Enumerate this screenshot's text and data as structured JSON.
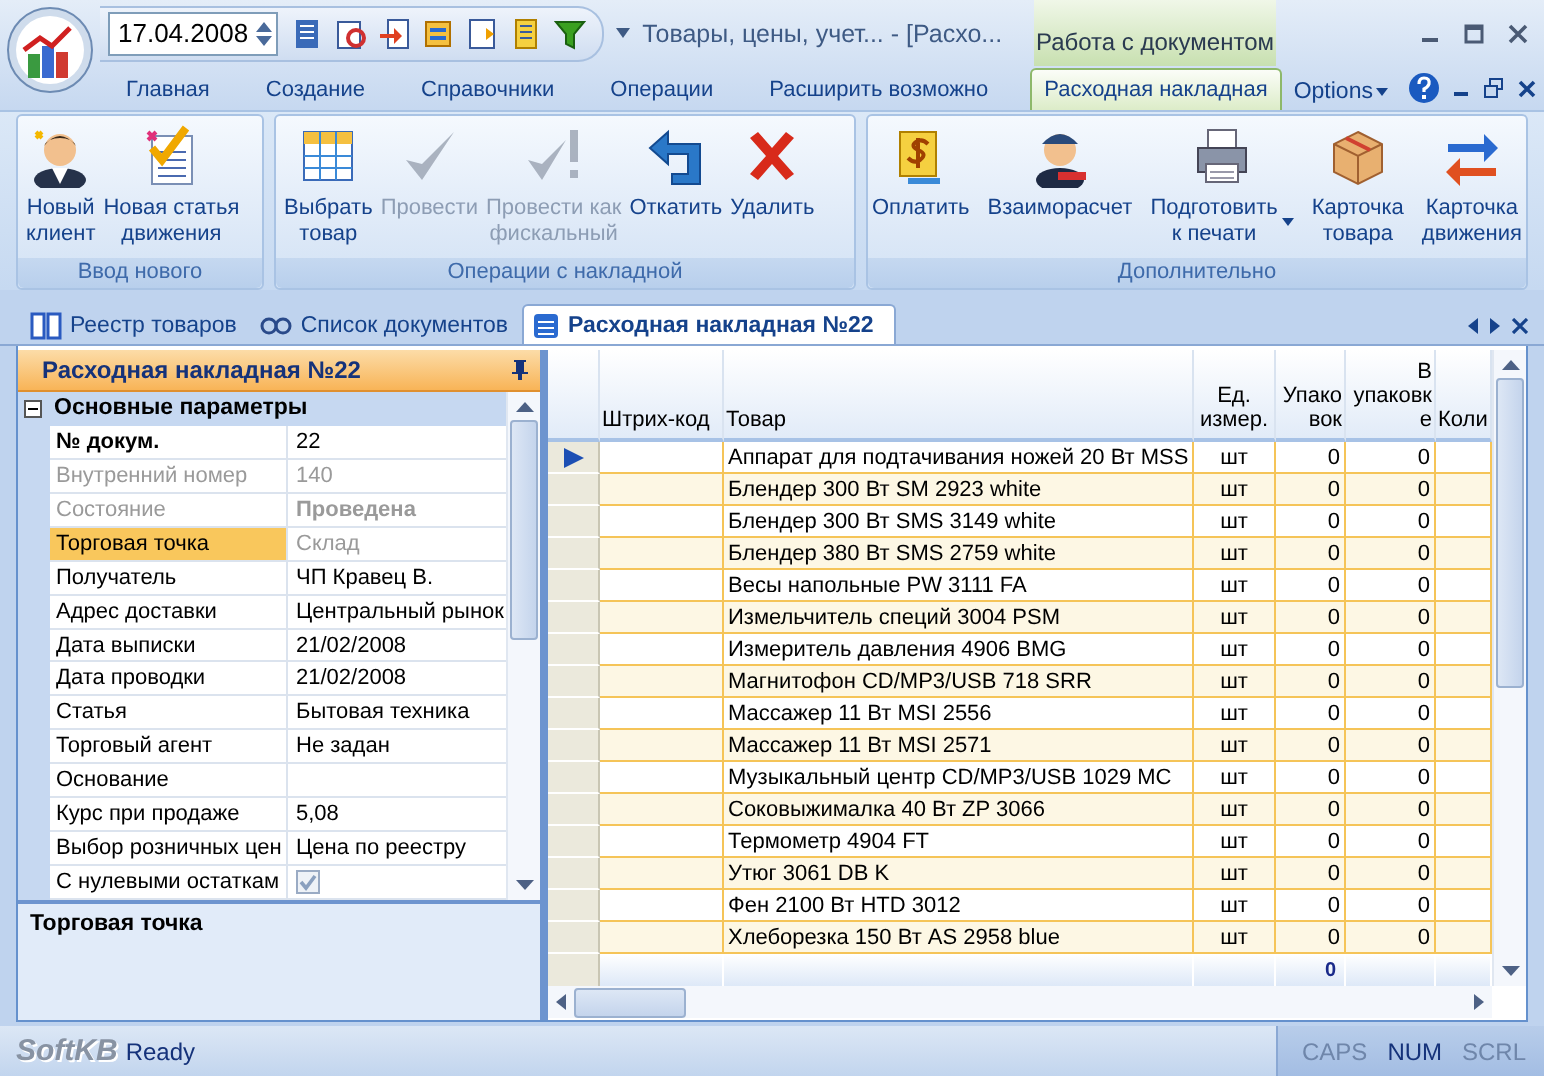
{
  "app": {
    "date": "17.04.2008",
    "title": "Товары, цены, учет... - [Расхо...",
    "contextual_group": "Работа с документом"
  },
  "ribbon_tabs": [
    {
      "label": "Главная",
      "selected": false,
      "contextual": false
    },
    {
      "label": "Создание",
      "selected": false,
      "contextual": false
    },
    {
      "label": "Справочники",
      "selected": false,
      "contextual": false
    },
    {
      "label": "Операции",
      "selected": false,
      "contextual": false
    },
    {
      "label": "Расширить возможно",
      "selected": false,
      "contextual": false
    },
    {
      "label": "Расходная накладная",
      "selected": true,
      "contextual": true
    }
  ],
  "options": "Options",
  "ribbon_groups": [
    {
      "title": "Ввод нового",
      "buttons": [
        {
          "label": "Новый\nклиент",
          "disabled": false
        },
        {
          "label": "Новая статья\nдвижения",
          "disabled": false
        }
      ]
    },
    {
      "title": "Операции с накладной",
      "buttons": [
        {
          "label": "Выбрать\nтовар",
          "disabled": false
        },
        {
          "label": "Провести",
          "disabled": true
        },
        {
          "label": "Провести как\nфискальный",
          "disabled": true
        },
        {
          "label": "Откатить",
          "disabled": false
        },
        {
          "label": "Удалить",
          "disabled": false
        }
      ]
    },
    {
      "title": "Дополнительно",
      "buttons": [
        {
          "label": "Оплатить",
          "disabled": false
        },
        {
          "label": "Взаиморасчет",
          "disabled": false
        },
        {
          "label": "Подготовить\nк печати",
          "disabled": false,
          "dropdown": true
        },
        {
          "label": "Карточка\nтовара",
          "disabled": false
        },
        {
          "label": "Карточка\nдвижения",
          "disabled": false
        }
      ]
    }
  ],
  "doc_tabs": [
    {
      "label": "Реестр товаров",
      "selected": false
    },
    {
      "label": "Список документов",
      "selected": false
    },
    {
      "label": "Расходная накладная №22",
      "selected": true
    }
  ],
  "property_panel": {
    "title": "Расходная накладная №22",
    "category": {
      "label": "Основные параметры",
      "expanded": true
    },
    "properties": [
      {
        "name": "№ докум.",
        "value": "22",
        "kind": "key",
        "disabled": false,
        "selected": false
      },
      {
        "name": "Внутренний номер",
        "value": "140",
        "kind": "text",
        "disabled": true,
        "selected": false
      },
      {
        "name": "Состояние",
        "value": "Проведена",
        "kind": "status",
        "disabled": true,
        "selected": false
      },
      {
        "name": "Торговая точка",
        "value": "Склад",
        "kind": "text",
        "disabled": true,
        "selected": true
      },
      {
        "name": "Получатель",
        "value": "ЧП Кравец В.",
        "kind": "text",
        "disabled": false,
        "selected": false
      },
      {
        "name": "Адрес доставки",
        "value": "Центральный рынок",
        "kind": "text",
        "disabled": false,
        "selected": false
      },
      {
        "name": "Дата выписки",
        "value": "21/02/2008",
        "kind": "text",
        "disabled": false,
        "selected": false
      },
      {
        "name": "Дата проводки",
        "value": "21/02/2008",
        "kind": "text",
        "disabled": false,
        "selected": false
      },
      {
        "name": "Статья",
        "value": "Бытовая техника",
        "kind": "text",
        "disabled": false,
        "selected": false
      },
      {
        "name": "Торговый агент",
        "value": "Не задан",
        "kind": "text",
        "disabled": false,
        "selected": false
      },
      {
        "name": "Основание",
        "kind": "text",
        "disabled": false,
        "selected": false
      },
      {
        "name": "Курс при продаже",
        "value": "5,08",
        "kind": "text",
        "disabled": false,
        "selected": false
      },
      {
        "name": "Выбор розничных цен",
        "value": "Цена по реестру",
        "kind": "text",
        "disabled": false,
        "selected": false
      },
      {
        "name": "С нулевыми остаткам",
        "kind": "checkbox",
        "checked": true,
        "disabled": false,
        "selected": false
      }
    ],
    "description": "Торговая точка"
  },
  "grid": {
    "columns": [
      "Штрих-код",
      "Товар",
      "Ед. измер.",
      "Упаковок",
      "В упаковке",
      "Коли"
    ],
    "rows": [
      {
        "product": "Аппарат для подтачивания ножей 20 Вт MSS",
        "unit": "шт",
        "packs": "0",
        "per_pack": "0",
        "current": true
      },
      {
        "product": "Блендер 300 Вт SM 2923 white",
        "unit": "шт",
        "packs": "0",
        "per_pack": "0",
        "current": false
      },
      {
        "product": "Блендер 300 Вт SMS 3149 white",
        "unit": "шт",
        "packs": "0",
        "per_pack": "0",
        "current": false
      },
      {
        "product": "Блендер 380 Вт SMS 2759 white",
        "unit": "шт",
        "packs": "0",
        "per_pack": "0",
        "current": false
      },
      {
        "product": "Весы напольные PW 3111 FA",
        "unit": "шт",
        "packs": "0",
        "per_pack": "0",
        "current": false
      },
      {
        "product": "Измельчитель специй 3004 PSM",
        "unit": "шт",
        "packs": "0",
        "per_pack": "0",
        "current": false
      },
      {
        "product": "Измеритель давления 4906 BMG",
        "unit": "шт",
        "packs": "0",
        "per_pack": "0",
        "current": false
      },
      {
        "product": "Магнитофон CD/MP3/USB 718 SRR",
        "unit": "шт",
        "packs": "0",
        "per_pack": "0",
        "current": false
      },
      {
        "product": "Массажер 11 Вт MSI 2556",
        "unit": "шт",
        "packs": "0",
        "per_pack": "0",
        "current": false
      },
      {
        "product": "Массажер 11 Вт MSI 2571",
        "unit": "шт",
        "packs": "0",
        "per_pack": "0",
        "current": false
      },
      {
        "product": "Музыкальный центр CD/MP3/USB 1029 MC",
        "unit": "шт",
        "packs": "0",
        "per_pack": "0",
        "current": false
      },
      {
        "product": "Соковыжималка 40 Вт ZP 3066",
        "unit": "шт",
        "packs": "0",
        "per_pack": "0",
        "current": false
      },
      {
        "product": "Термометр 4904 FT",
        "unit": "шт",
        "packs": "0",
        "per_pack": "0",
        "current": false
      },
      {
        "product": "Утюг 3061 DB K",
        "unit": "шт",
        "packs": "0",
        "per_pack": "0",
        "current": false
      },
      {
        "product": "Фен 2100 Вт HTD 3012",
        "unit": "шт",
        "packs": "0",
        "per_pack": "0",
        "current": false
      },
      {
        "product": "Хлеборезка 150 Вт AS 2958 blue",
        "unit": "шт",
        "packs": "0",
        "per_pack": "0",
        "current": false
      }
    ],
    "total": "0"
  },
  "status_bar": {
    "logo": "SoftKB",
    "text": "Ready",
    "indicators": [
      {
        "label": "CAPS",
        "active": false
      },
      {
        "label": "NUM",
        "active": true
      },
      {
        "label": "SCRL",
        "active": false
      }
    ]
  }
}
